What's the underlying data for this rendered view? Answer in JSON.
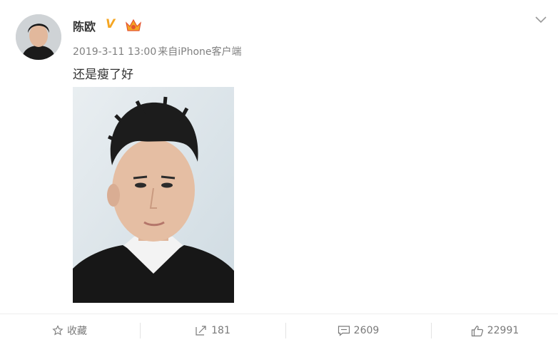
{
  "user": {
    "name": "陈欧",
    "verified_icon": "V"
  },
  "post": {
    "timestamp": "2019-3-11 13:00",
    "source": "来自iPhone客户端",
    "text": "还是瘦了好"
  },
  "actions": {
    "favorite_label": "收藏",
    "repost_count": "181",
    "comment_count": "2609",
    "like_count": "22991"
  },
  "icons": {
    "favorite": "star-icon",
    "repost": "repost-icon",
    "comment": "comment-icon",
    "like": "thumbs-up-icon",
    "menu": "chevron-down-icon"
  },
  "colors": {
    "verified": "#f5a623",
    "meta_text": "#808080",
    "action_text": "#7a7a7a"
  }
}
